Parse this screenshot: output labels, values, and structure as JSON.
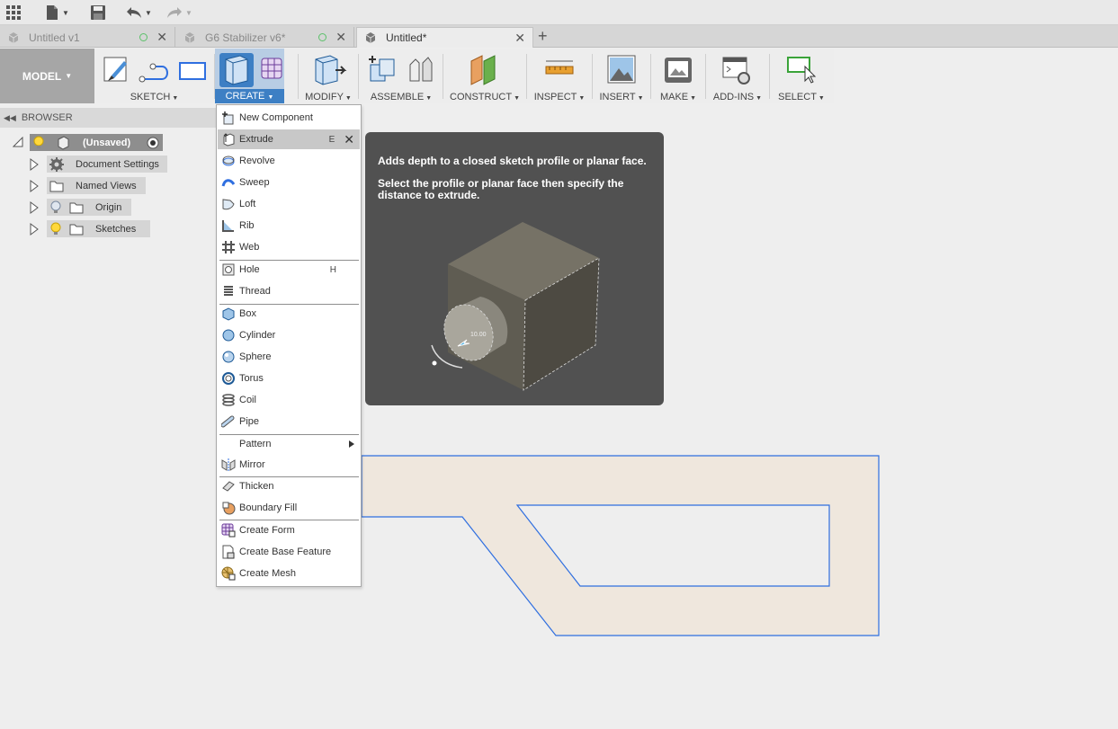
{
  "app": {
    "tabs": [
      {
        "label": "Untitled v1",
        "active": false
      },
      {
        "label": "G6 Stabilizer v6*",
        "active": false
      },
      {
        "label": "Untitled*",
        "active": true
      }
    ]
  },
  "ribbon": {
    "workspace": "MODEL",
    "groups": [
      {
        "label": "SKETCH"
      },
      {
        "label": "CREATE"
      },
      {
        "label": "MODIFY"
      },
      {
        "label": "ASSEMBLE"
      },
      {
        "label": "CONSTRUCT"
      },
      {
        "label": "INSPECT"
      },
      {
        "label": "INSERT"
      },
      {
        "label": "MAKE"
      },
      {
        "label": "ADD-INS"
      },
      {
        "label": "SELECT"
      }
    ]
  },
  "browser": {
    "title": "BROWSER",
    "root": "(Unsaved)",
    "items": [
      {
        "label": "Document Settings"
      },
      {
        "label": "Named Views"
      },
      {
        "label": "Origin"
      },
      {
        "label": "Sketches"
      }
    ]
  },
  "create_menu": {
    "items": [
      {
        "label": "New Component",
        "shortcut": ""
      },
      {
        "label": "Extrude",
        "shortcut": "E"
      },
      {
        "label": "Revolve",
        "shortcut": ""
      },
      {
        "label": "Sweep",
        "shortcut": ""
      },
      {
        "label": "Loft",
        "shortcut": ""
      },
      {
        "label": "Rib",
        "shortcut": ""
      },
      {
        "label": "Web",
        "shortcut": ""
      },
      {
        "label": "Hole",
        "shortcut": "H"
      },
      {
        "label": "Thread",
        "shortcut": ""
      },
      {
        "label": "Box",
        "shortcut": ""
      },
      {
        "label": "Cylinder",
        "shortcut": ""
      },
      {
        "label": "Sphere",
        "shortcut": ""
      },
      {
        "label": "Torus",
        "shortcut": ""
      },
      {
        "label": "Coil",
        "shortcut": ""
      },
      {
        "label": "Pipe",
        "shortcut": ""
      },
      {
        "label": "Pattern",
        "shortcut": ""
      },
      {
        "label": "Mirror",
        "shortcut": ""
      },
      {
        "label": "Thicken",
        "shortcut": ""
      },
      {
        "label": "Boundary Fill",
        "shortcut": ""
      },
      {
        "label": "Create Form",
        "shortcut": ""
      },
      {
        "label": "Create Base Feature",
        "shortcut": ""
      },
      {
        "label": "Create Mesh",
        "shortcut": ""
      }
    ]
  },
  "tooltip": {
    "line1": "Adds depth to a closed sketch profile or planar face.",
    "line2": "Select the profile or planar face then specify the distance to extrude.",
    "dim_value": "10.00"
  },
  "colors": {
    "accent": "#3d7fc4",
    "sketch_line": "#2f6fe0",
    "sketch_fill": "#efe7dd",
    "tooltip_bg": "#515151"
  }
}
